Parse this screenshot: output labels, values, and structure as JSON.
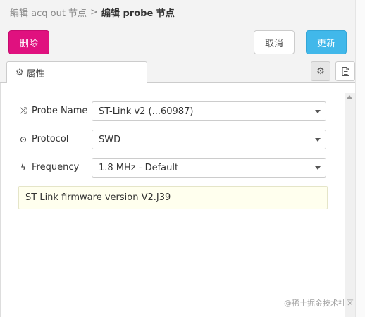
{
  "breadcrumb": {
    "parent": "编辑 acq out 节点",
    "separator": ">",
    "current": "编辑 probe 节点"
  },
  "buttons": {
    "delete": "删除",
    "cancel": "取消",
    "update": "更新"
  },
  "tabs": {
    "properties": "属性"
  },
  "icons": {
    "properties_tab": "gear-icon",
    "settings_button": "gear-icon",
    "info_button": "document-icon",
    "probe_name": "shuffle-icon",
    "protocol": "dot-circle-icon",
    "frequency": "bolt-icon"
  },
  "form": {
    "probe_name": {
      "label": "Probe Name",
      "value": "ST-Link v2 (...60987)"
    },
    "protocol": {
      "label": "Protocol",
      "value": "SWD"
    },
    "frequency": {
      "label": "Frequency",
      "value": "1.8 MHz - Default"
    }
  },
  "info": "ST Link firmware version V2.J39",
  "watermark": "@稀土掘金技术社区",
  "colors": {
    "delete": "#e0117f",
    "update": "#41b8ea",
    "info_bg": "#ffffee"
  }
}
